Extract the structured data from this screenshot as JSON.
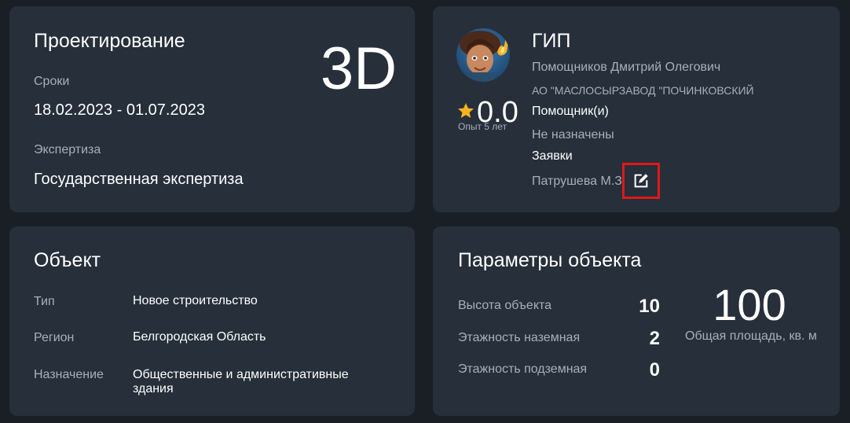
{
  "design": {
    "title": "Проектирование",
    "badge": "3D",
    "terms_label": "Сроки",
    "terms_value": "18.02.2023 - 01.07.2023",
    "expertise_label": "Экспертиза",
    "expertise_value": "Государственная экспертиза"
  },
  "gip": {
    "title": "ГИП",
    "name": "Помощников Дмитрий Олегович",
    "org": "АО \"МАСЛОСЫРЗАВОД \"ПОЧИНКОВСКИЙ",
    "rating": "0.0",
    "experience": "Опыт 5 лет",
    "assistants_label": "Помощник(и)",
    "assistants_value": "Не назначены",
    "requests_label": "Заявки",
    "requests_value": "Патрушева М.З.",
    "star_color": "#f5b323",
    "edit_icon": "pencil-edit-icon"
  },
  "object": {
    "title": "Объект",
    "rows": [
      {
        "label": "Тип",
        "value": "Новое строительство"
      },
      {
        "label": "Регион",
        "value": "Белгородская Область"
      },
      {
        "label": "Назначение",
        "value": "Общественные и административные здания"
      }
    ]
  },
  "params": {
    "title": "Параметры объекта",
    "rows": [
      {
        "label": "Высота объекта",
        "value": "10"
      },
      {
        "label": "Этажность наземная",
        "value": "2"
      },
      {
        "label": "Этажность подземная",
        "value": "0"
      }
    ],
    "area_value": "100",
    "area_label": "Общая площадь, кв. м"
  }
}
